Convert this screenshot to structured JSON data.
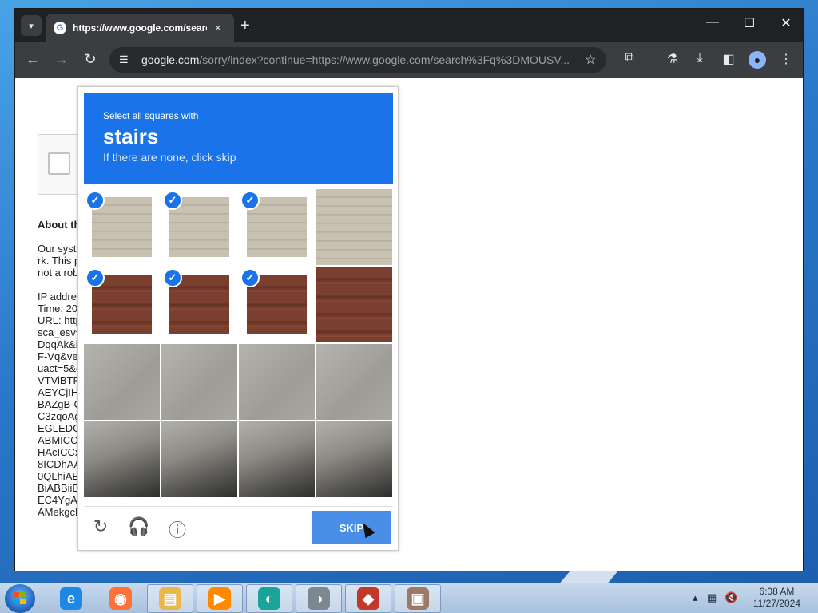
{
  "browser": {
    "tab_title": "https://www.google.com/search",
    "tab_close": "×",
    "new_tab": "+",
    "url_host": "google.com",
    "url_rest": "/sorry/index?continue=https://www.google.com/search%3Fq%3DMOUSV...",
    "win_min": "—",
    "win_max": "☐",
    "win_close": "✕"
  },
  "page": {
    "about_heading": "About th",
    "para_lines": [
      "Our syste",
      "rk. This p",
      "not a rob"
    ],
    "info_lines": [
      "IP addres",
      "Time: 20",
      "URL: http",
      "sca_esv=",
      "DqqAk&i",
      "F-Vq&ve",
      "uact=5&c",
      "VTViBTR",
      "AEYCjIH",
      "BAZgB-C",
      "C3zqoAg",
      "EGLEDG",
      "ABMICC",
      "HAcICCx",
      "8ICDhAA",
      "0QLhiAB",
      "BiABBiiB",
      "EC4YgA",
      "AMekgcN"
    ]
  },
  "captcha": {
    "instruction": "Select all squares with",
    "keyword": "stairs",
    "hint": "If there are none, click skip",
    "skip_label": "SKIP",
    "tiles": [
      {
        "texture": "siding",
        "selected": true
      },
      {
        "texture": "siding",
        "selected": true
      },
      {
        "texture": "siding",
        "selected": true
      },
      {
        "texture": "siding",
        "selected": false
      },
      {
        "texture": "steps",
        "selected": true
      },
      {
        "texture": "steps",
        "selected": true
      },
      {
        "texture": "steps",
        "selected": true
      },
      {
        "texture": "steps",
        "selected": false
      },
      {
        "texture": "pavement",
        "selected": false
      },
      {
        "texture": "pavement",
        "selected": false
      },
      {
        "texture": "pavement",
        "selected": false
      },
      {
        "texture": "pavement",
        "selected": false
      },
      {
        "texture": "carpart",
        "selected": false
      },
      {
        "texture": "carpart",
        "selected": false
      },
      {
        "texture": "carpart",
        "selected": false
      },
      {
        "texture": "carpart",
        "selected": false
      }
    ]
  },
  "taskbar": {
    "apps": [
      {
        "name": "internet-explorer",
        "color": "#1e88e5",
        "glyph": "e",
        "running": false
      },
      {
        "name": "firefox",
        "color": "#ff7139",
        "glyph": "◉",
        "running": false
      },
      {
        "name": "file-explorer",
        "color": "#e8b84a",
        "glyph": "▤",
        "running": true
      },
      {
        "name": "media-player",
        "color": "#ff8a00",
        "glyph": "▶",
        "running": true
      },
      {
        "name": "app-teal",
        "color": "#1aa39a",
        "glyph": "◐",
        "running": true
      },
      {
        "name": "app-gray",
        "color": "#7d8790",
        "glyph": "◑",
        "running": true
      },
      {
        "name": "app-blocks",
        "color": "#c0392b",
        "glyph": "◆",
        "running": true
      },
      {
        "name": "app-box",
        "color": "#9b7a6a",
        "glyph": "▣",
        "running": true
      }
    ],
    "time": "6:08 AM",
    "date": "11/27/2024"
  },
  "colors": {
    "captcha_header": "#1a73e8",
    "skip_button": "#4a8fe7",
    "checkmark": "#1a73e8"
  }
}
